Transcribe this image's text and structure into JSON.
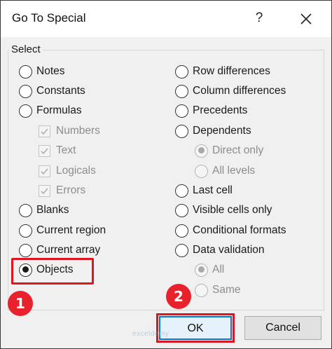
{
  "dialog": {
    "title": "Go To Special",
    "help_label": "?",
    "close_icon": "close-icon",
    "group_label": "Select"
  },
  "left_options": [
    {
      "label": "Notes",
      "checked": false
    },
    {
      "label": "Constants",
      "checked": false
    },
    {
      "label": "Formulas",
      "checked": false
    },
    {
      "label": "Blanks",
      "checked": false
    },
    {
      "label": "Current region",
      "checked": false
    },
    {
      "label": "Current array",
      "checked": false
    },
    {
      "label": "Objects",
      "checked": true
    }
  ],
  "formula_sub_options": [
    {
      "label": "Numbers",
      "checked": true
    },
    {
      "label": "Text",
      "checked": true
    },
    {
      "label": "Logicals",
      "checked": true
    },
    {
      "label": "Errors",
      "checked": true
    }
  ],
  "right_options": [
    {
      "label": "Row differences",
      "checked": false
    },
    {
      "label": "Column differences",
      "checked": false
    },
    {
      "label": "Precedents",
      "checked": false
    },
    {
      "label": "Dependents",
      "checked": false
    },
    {
      "label": "Last cell",
      "checked": false
    },
    {
      "label": "Visible cells only",
      "checked": false
    },
    {
      "label": "Conditional formats",
      "checked": false
    },
    {
      "label": "Data validation",
      "checked": false
    }
  ],
  "dependents_sub_options": [
    {
      "label": "Direct only",
      "checked": true
    },
    {
      "label": "All levels",
      "checked": false
    }
  ],
  "validation_sub_options": [
    {
      "label": "All",
      "checked": true
    },
    {
      "label": "Same",
      "checked": false
    }
  ],
  "buttons": {
    "ok": "OK",
    "cancel": "Cancel"
  },
  "annotations": {
    "step1": "1",
    "step2": "2",
    "highlight_color": "#e0141f"
  },
  "watermark": "exceldemy"
}
